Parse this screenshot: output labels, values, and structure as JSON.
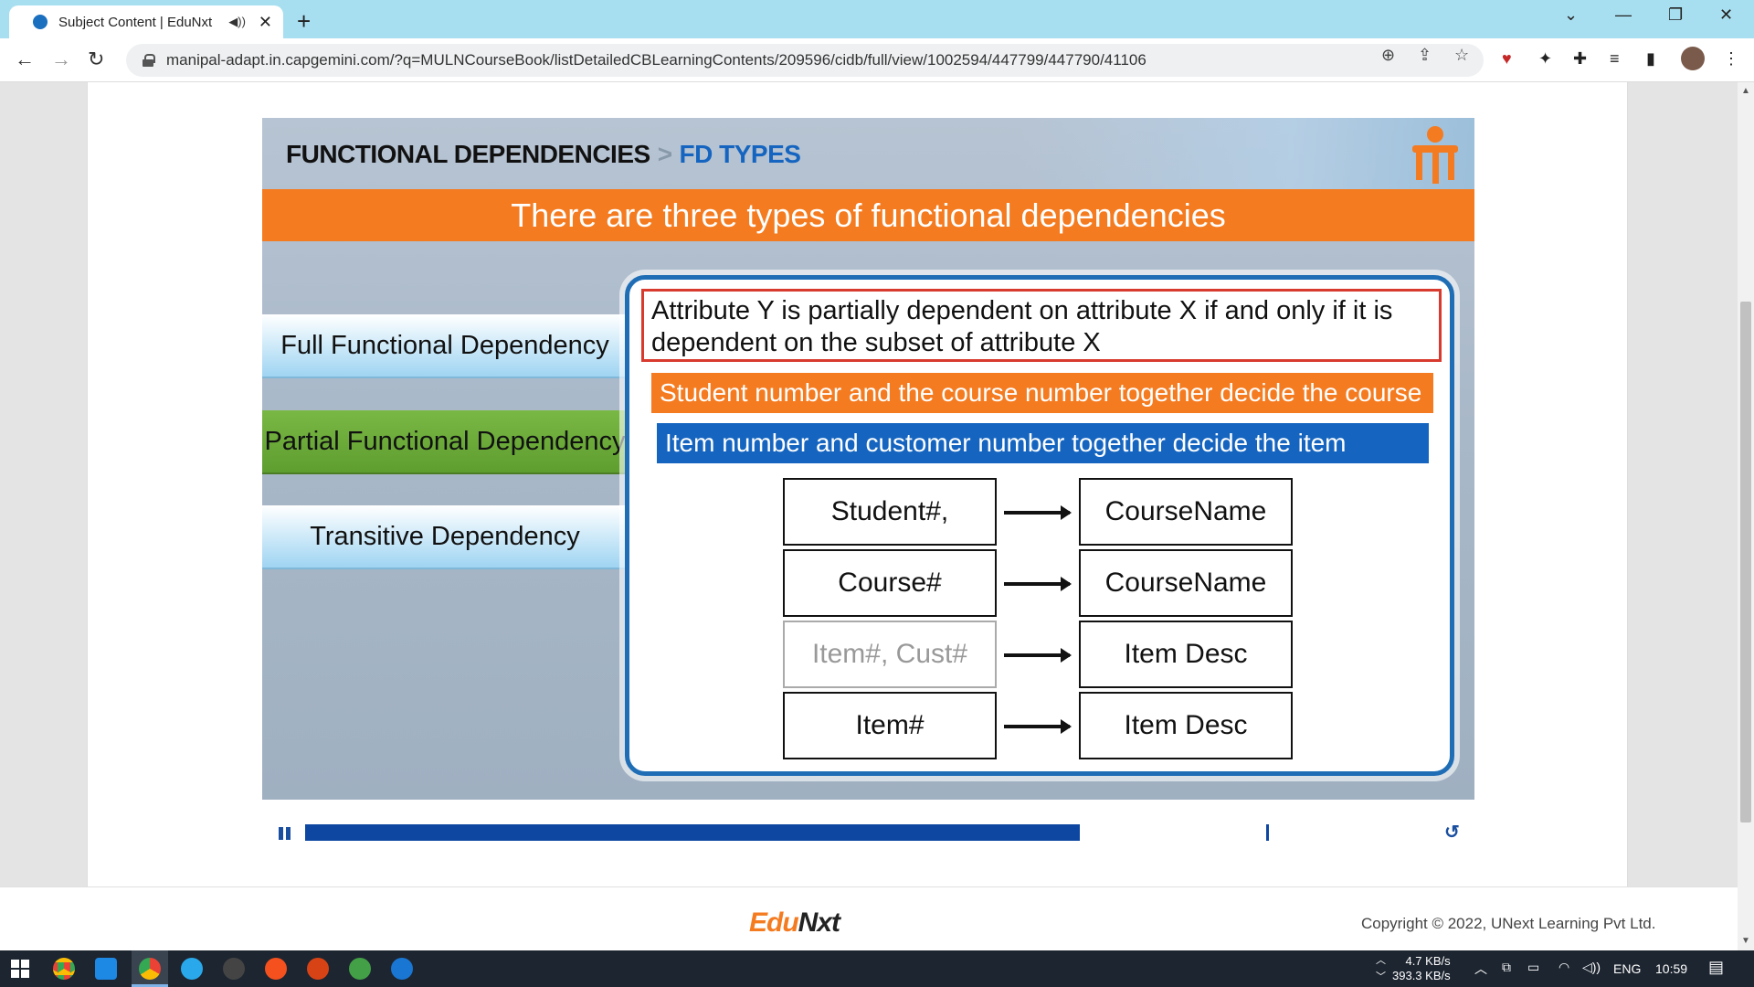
{
  "browser": {
    "tab_title": "Subject Content | EduNxt",
    "url": "manipal-adapt.in.capgemini.com/?q=MULNCourseBook/listDetailedCBLearningContents/209596/cidb/full/view/1002594/447799/447790/41106"
  },
  "slide": {
    "header_main": "FUNCTIONAL DEPENDENCIES",
    "header_sep": ">",
    "header_sub": "FD TYPES",
    "banner": "There are three types of functional dependencies",
    "types": [
      {
        "label": "Full Functional Dependency"
      },
      {
        "label": "Partial Functional Dependency"
      },
      {
        "label": "Transitive Dependency"
      }
    ],
    "definition": "Attribute Y is partially dependent on attribute X if and only if it is dependent on the subset of attribute X",
    "example_1": "Student number and the course number together decide the course name",
    "example_2": "Item number and customer number together decide the item description",
    "rows": [
      {
        "left": "Student#, Course#",
        "right": "CourseName"
      },
      {
        "left": "Course#",
        "right": "CourseName"
      },
      {
        "left": "Item#, Cust#",
        "right": "Item Desc"
      },
      {
        "left": "Item#",
        "right": "Item Desc"
      }
    ]
  },
  "player": {
    "progress": 0.8
  },
  "footer": {
    "logo_edu": "Edu",
    "logo_nxt": "Nxt",
    "copyright": "Copyright © 2022, UNext Learning Pvt Ltd."
  },
  "taskbar": {
    "net_up": "4.7 KB/s",
    "net_down": "393.3 KB/s",
    "language": "ENG",
    "time": "10:59"
  },
  "colors": {
    "accent_orange": "#f47b20",
    "accent_blue": "#1565c0",
    "active_green": "#6aaa3a"
  }
}
